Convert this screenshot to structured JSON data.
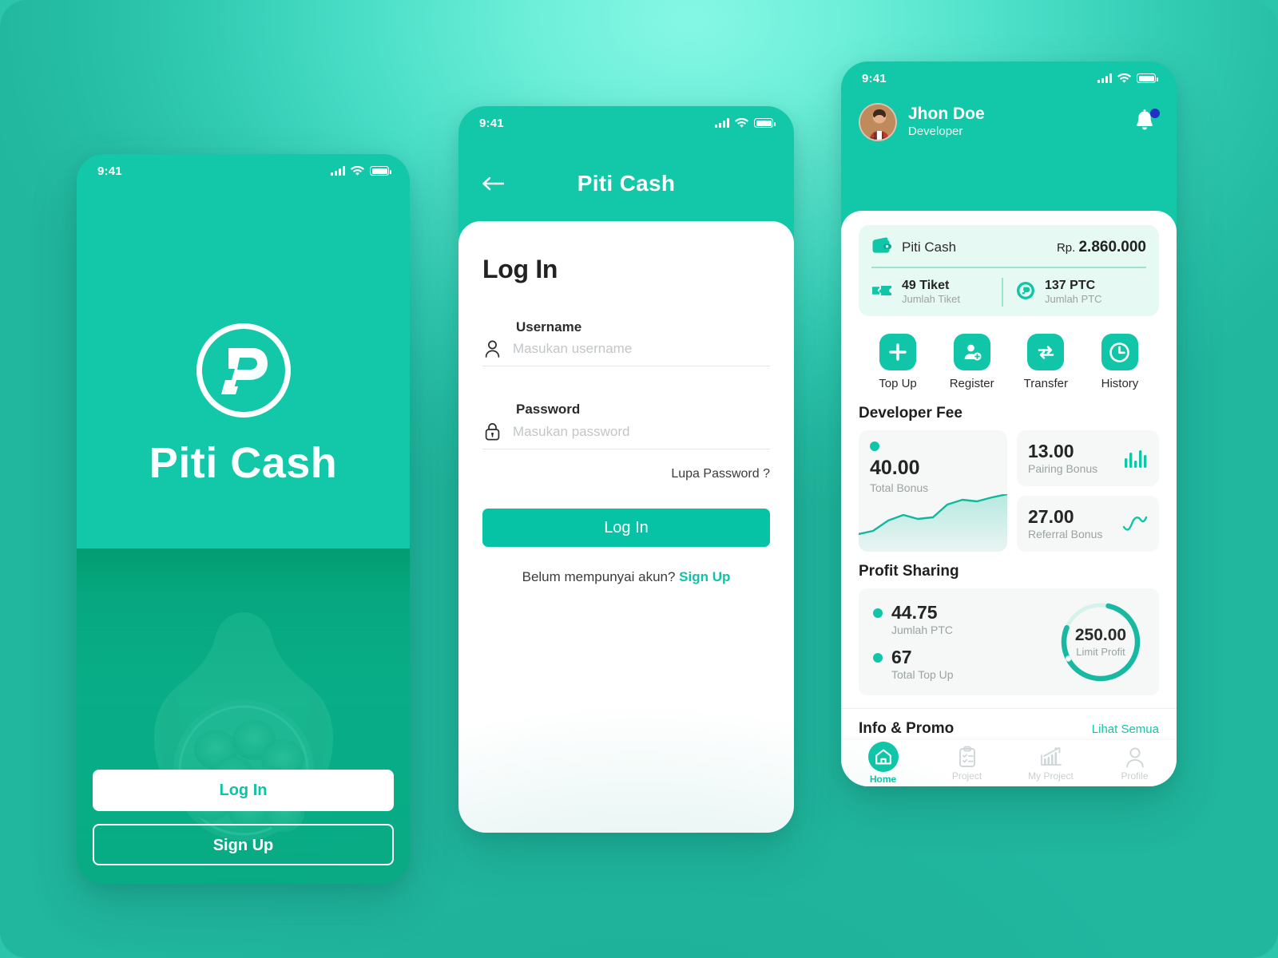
{
  "app": {
    "name": "Piti Cash",
    "accent": "#10c5a8",
    "accent_dark": "#07c3a6",
    "bg_light": "#7ef5e2",
    "bg_deep": "#25bda4"
  },
  "status_bar": {
    "time": "9:41",
    "cellular_icon": "signal-bars-icon",
    "wifi_icon": "wifi-icon",
    "battery_icon": "battery-icon"
  },
  "splash": {
    "logo_icon": "piti-cash-logo-icon",
    "brand": "Piti Cash",
    "photo_alt": "hands-holding-coins-image",
    "login_label": "Log In",
    "signup_label": "Sign Up"
  },
  "login": {
    "back_icon": "back-arrow-icon",
    "title": "Piti Cash",
    "heading": "Log In",
    "username": {
      "label": "Username",
      "placeholder": "Masukan username",
      "value": "",
      "icon": "user-icon"
    },
    "password": {
      "label": "Password",
      "placeholder": "Masukan password",
      "value": "",
      "icon": "lock-icon"
    },
    "forgot_label": "Lupa Password ?",
    "submit_label": "Log In",
    "signup_prompt": "Belum mempunyai akun?",
    "signup_link": "Sign Up"
  },
  "home": {
    "user": {
      "name": "Jhon Doe",
      "role": "Developer",
      "avatar": "user-avatar"
    },
    "bell_icon": "notification-bell-icon",
    "balance": {
      "wallet_icon": "wallet-icon",
      "label": "Piti Cash",
      "currency": "Rp.",
      "amount": "2.860.000",
      "stats": [
        {
          "icon": "ticket-icon",
          "value": "49 Tiket",
          "label": "Jumlah Tiket"
        },
        {
          "icon": "ptc-coin-icon",
          "value": "137 PTC",
          "label": "Jumlah PTC"
        }
      ]
    },
    "quick_actions": [
      {
        "icon": "plus-icon",
        "label": "Top Up"
      },
      {
        "icon": "user-add-icon",
        "label": "Register"
      },
      {
        "icon": "transfer-icon",
        "label": "Transfer"
      },
      {
        "icon": "clock-history-icon",
        "label": "History"
      }
    ],
    "developer_fee": {
      "title": "Developer Fee",
      "total_bonus": {
        "value": "40.00",
        "label": "Total Bonus",
        "chart_icon": "area-chart-icon"
      },
      "pairing_bonus": {
        "value": "13.00",
        "label": "Pairing Bonus",
        "chart_icon": "bar-chart-icon"
      },
      "referral_bonus": {
        "value": "27.00",
        "label": "Referral Bonus",
        "chart_icon": "line-chart-icon"
      }
    },
    "profit_sharing": {
      "title": "Profit Sharing",
      "items": [
        {
          "value": "44.75",
          "label": "Jumlah PTC"
        },
        {
          "value": "67",
          "label": "Total Top Up"
        }
      ],
      "gauge": {
        "value": "250.00",
        "label": "Limit Profit"
      }
    },
    "info_promo": {
      "title": "Info & Promo",
      "see_all": "Lihat Semua",
      "banner_alt": "promo-banner-image"
    },
    "tabs": [
      {
        "icon": "home-icon",
        "label": "Home",
        "active": true
      },
      {
        "icon": "clipboard-check-icon",
        "label": "Project",
        "active": false
      },
      {
        "icon": "chart-growth-icon",
        "label": "My Project",
        "active": false
      },
      {
        "icon": "profile-person-icon",
        "label": "Profile",
        "active": false
      }
    ]
  },
  "chart_data": [
    {
      "type": "area",
      "title": "Total Bonus",
      "value": 40.0,
      "x": [
        0,
        1,
        2,
        3,
        4,
        5,
        6,
        7,
        8,
        9,
        10
      ],
      "values": [
        18,
        20,
        28,
        33,
        30,
        31,
        45,
        52,
        50,
        56,
        62
      ],
      "ylim": [
        0,
        70
      ],
      "grid": false,
      "legend": "none",
      "color": "#10c5a8"
    },
    {
      "type": "bar",
      "title": "Pairing Bonus",
      "value": 13.0,
      "categories": [
        "1",
        "2",
        "3",
        "4",
        "5"
      ],
      "values": [
        9,
        15,
        6,
        17,
        12
      ],
      "ylim": [
        0,
        20
      ],
      "grid": false,
      "legend": "none",
      "color": "#10c5a8"
    },
    {
      "type": "line",
      "title": "Referral Bonus",
      "value": 27.0,
      "x": [
        0,
        1,
        2,
        3,
        4
      ],
      "values": [
        12,
        4,
        10,
        18,
        24
      ],
      "ylim": [
        0,
        28
      ],
      "grid": false,
      "legend": "none",
      "color": "#10c5a8"
    },
    {
      "type": "pie",
      "title": "Limit Profit",
      "center_value": "250.00",
      "center_label": "Limit Profit",
      "values": [
        78,
        22
      ],
      "labels": [
        "Used",
        "Remaining"
      ],
      "colors": [
        "#17b9a2",
        "#d6f2ec"
      ],
      "legend": "none"
    }
  ]
}
